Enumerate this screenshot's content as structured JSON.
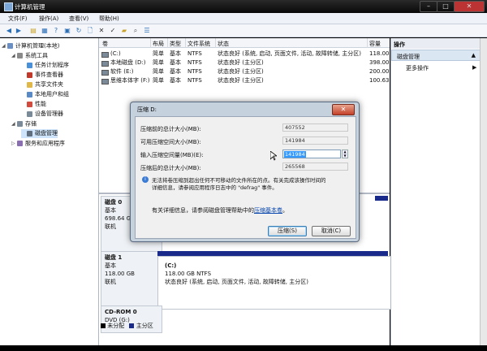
{
  "window": {
    "title": "计算机管理",
    "controls": [
      "–",
      "□",
      "✕"
    ]
  },
  "menu": [
    "文件(F)",
    "操作(A)",
    "查看(V)",
    "帮助(H)"
  ],
  "tree": {
    "items": [
      {
        "label": "计算机管理(本地)",
        "level": 0,
        "expanded": true,
        "icon": "computer-icon"
      },
      {
        "label": "系统工具",
        "level": 1,
        "expanded": true,
        "icon": "tools-icon"
      },
      {
        "label": "任务计划程序",
        "level": 2,
        "icon": "clock-icon"
      },
      {
        "label": "事件查看器",
        "level": 2,
        "icon": "event-icon"
      },
      {
        "label": "共享文件夹",
        "level": 2,
        "icon": "folder-icon"
      },
      {
        "label": "本地用户和组",
        "level": 2,
        "icon": "users-icon"
      },
      {
        "label": "性能",
        "level": 2,
        "icon": "performance-icon"
      },
      {
        "label": "设备管理器",
        "level": 2,
        "icon": "device-icon"
      },
      {
        "label": "存储",
        "level": 1,
        "expanded": true,
        "icon": "storage-icon"
      },
      {
        "label": "磁盘管理",
        "level": 2,
        "selected": true,
        "icon": "disk-icon"
      },
      {
        "label": "服务和应用程序",
        "level": 1,
        "icon": "services-icon"
      }
    ]
  },
  "volume_list": {
    "columns": [
      "卷",
      "布局",
      "类型",
      "文件系统",
      "状态",
      "容量"
    ],
    "rows": [
      [
        "(C:)",
        "简单",
        "基本",
        "NTFS",
        "状态良好 (系统, 启动, 页面文件, 活动, 故障转储, 主分区)",
        "118.00"
      ],
      [
        "本地磁盘 (D:)",
        "简单",
        "基本",
        "NTFS",
        "状态良好 (主分区)",
        "398.00"
      ],
      [
        "软件 (E:)",
        "简单",
        "基本",
        "NTFS",
        "状态良好 (主分区)",
        "200.00"
      ],
      [
        "思维本体字 (F:)",
        "简单",
        "基本",
        "NTFS",
        "状态良好 (主分区)",
        "100.63"
      ]
    ]
  },
  "disks": [
    {
      "name": "磁盘 0",
      "type": "基本",
      "size": "698.64 GB",
      "status": "联机"
    },
    {
      "name": "磁盘 1",
      "type": "基本",
      "size": "118.00 GB",
      "status": "联机",
      "partition": {
        "name": "(C:)",
        "fs": "118.00 GB NTFS",
        "status": "状态良好 (系统, 启动, 页面文件, 活动, 故障转储, 主分区)"
      }
    },
    {
      "name": "CD-ROM 0",
      "type": "DVD (G:)",
      "size": "",
      "status": ""
    }
  ],
  "legend": [
    "未分配",
    "主分区"
  ],
  "actions": {
    "header": "操作",
    "section": "磁盘管理",
    "more": "更多操作"
  },
  "dialog": {
    "title": "压缩 D:",
    "close": "✕",
    "fields": [
      {
        "label": "压缩前的总计大小(MB):",
        "value": "407552"
      },
      {
        "label": "可用压缩空间大小(MB):",
        "value": "141984"
      },
      {
        "label": "输入压缩空间量(MB)(E):",
        "value": "141984"
      },
      {
        "label": "压缩后的总计大小(MB):",
        "value": "265568"
      }
    ],
    "info_line1": "无法将卷压缩到超出任何不可移动的文件所在的点。有关完成该操作时间的",
    "info_line2": "详细信息，请参阅应用程序日志中的 \"defrag\" 事件。",
    "help_prefix": "有关详细信息，请参阅磁盘管理帮助中的",
    "help_link": "压缩基本卷",
    "help_suffix": "。",
    "ok_label": "压缩(S)",
    "cancel_label": "取消(C)"
  }
}
